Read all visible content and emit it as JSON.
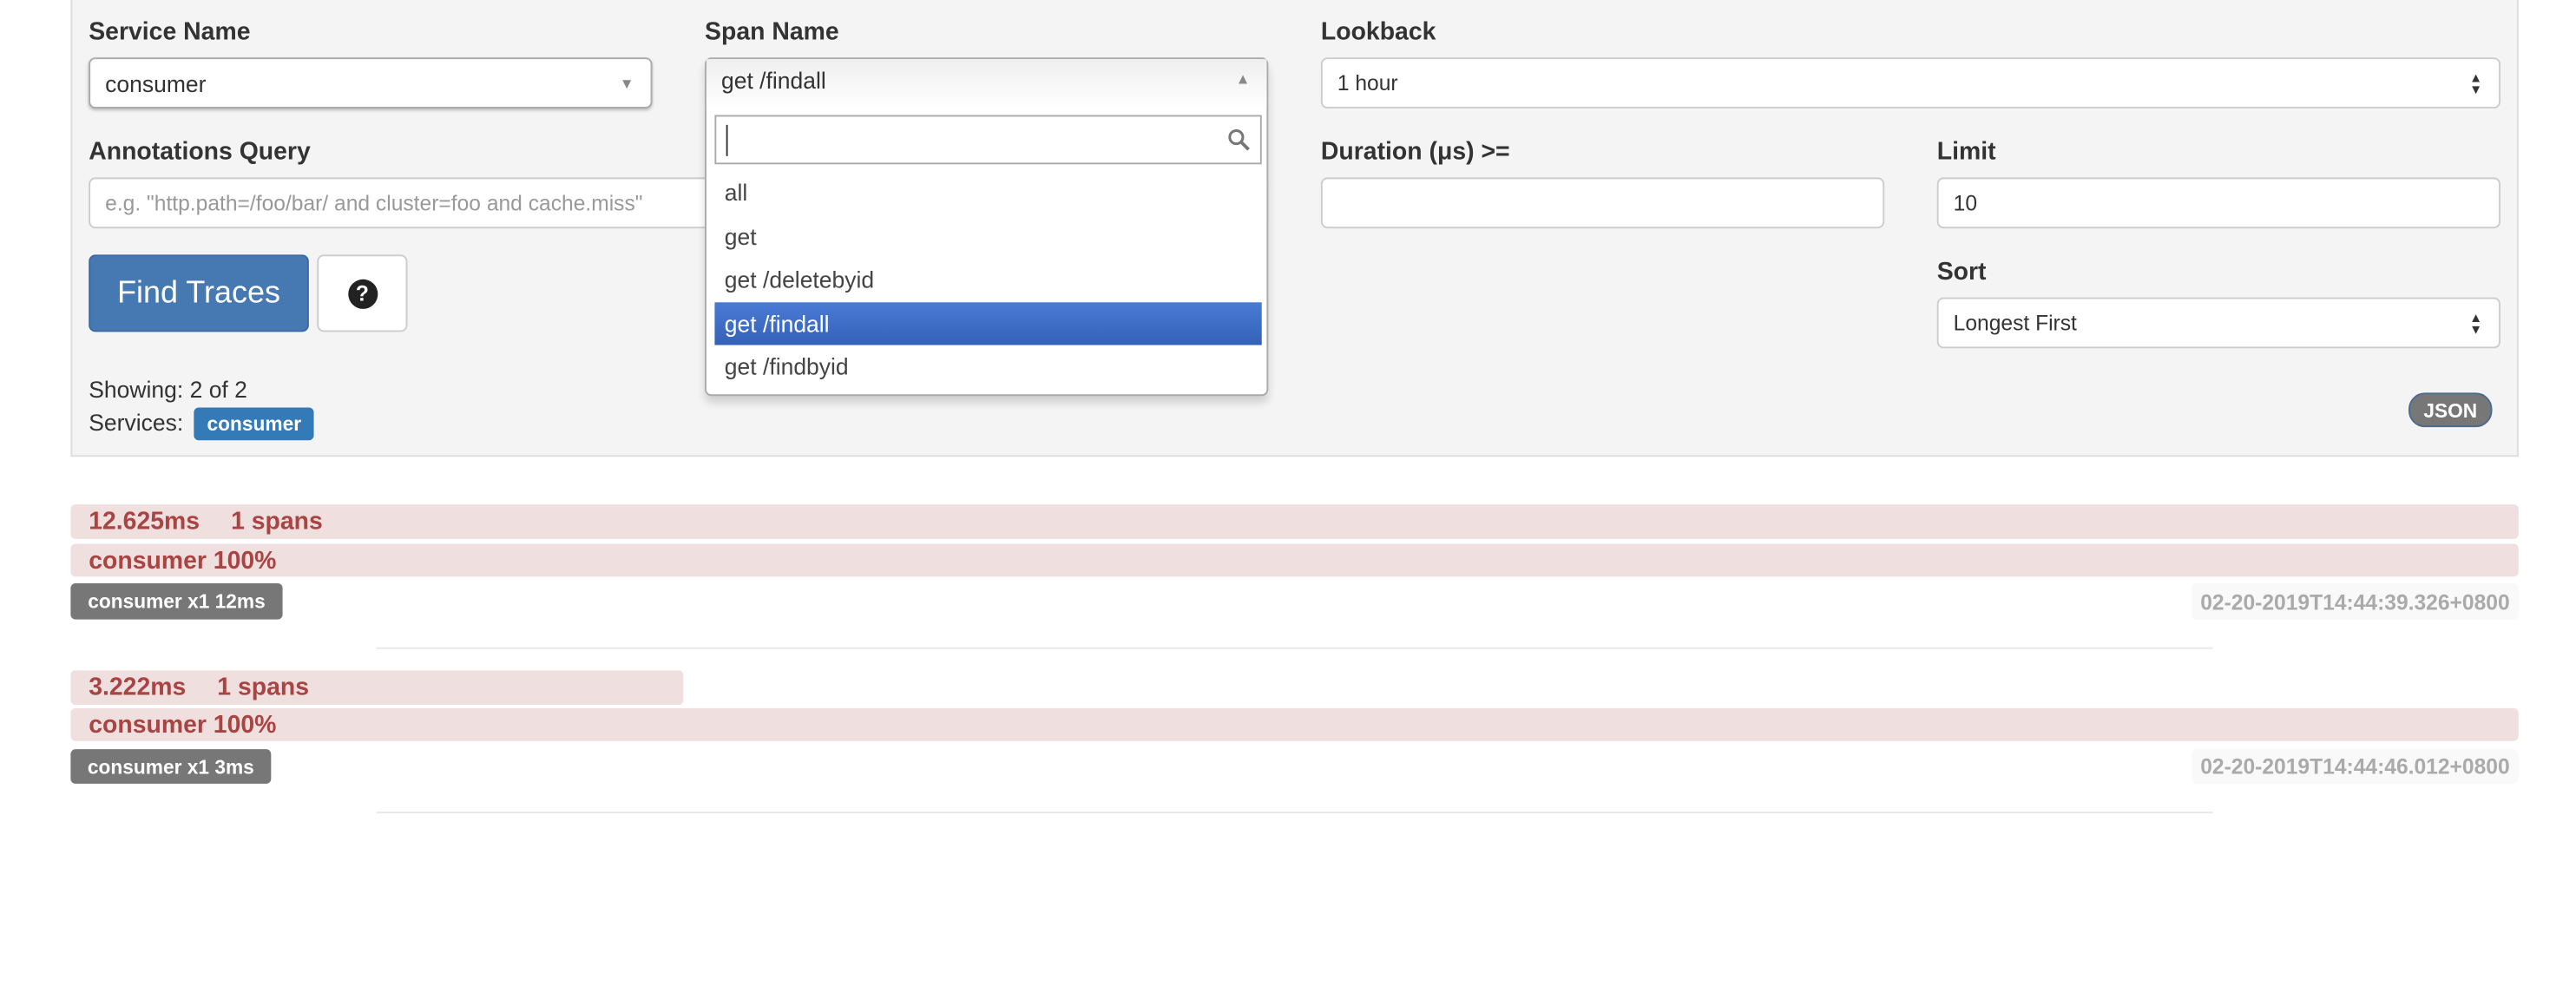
{
  "form": {
    "service_name": {
      "label": "Service Name",
      "value": "consumer"
    },
    "span_name": {
      "label": "Span Name",
      "value": "get /findall",
      "search_value": "",
      "options": [
        "all",
        "get",
        "get /deletebyid",
        "get /findall",
        "get /findbyid"
      ],
      "selected_index": 3
    },
    "lookback": {
      "label": "Lookback",
      "value": "1 hour"
    },
    "annotations_query": {
      "label": "Annotations Query",
      "placeholder": "e.g. \"http.path=/foo/bar/ and cluster=foo and cache.miss\""
    },
    "duration": {
      "label": "Duration (μs) >=",
      "value": ""
    },
    "limit": {
      "label": "Limit",
      "value": "10"
    },
    "sort": {
      "label": "Sort",
      "value": "Longest First"
    },
    "find_button": "Find Traces",
    "help_icon": "question-circle-icon"
  },
  "results": {
    "showing": "Showing: 2 of 2",
    "services_label": "Services:",
    "service_badge": "consumer",
    "json_button": "JSON"
  },
  "colors": {
    "primary": "#4679b2",
    "badge_blue": "#337ab7",
    "trace_bar": "#efdfdf",
    "trace_text": "#a94442",
    "selected_option": "#3d6fc8"
  },
  "traces": [
    {
      "duration": "12.625ms",
      "spans": "1 spans",
      "service_pct": "consumer 100%",
      "badge": "consumer x1 12ms",
      "timestamp": "02-20-2019T14:44:39.326+0800",
      "relative_width": 1.0
    },
    {
      "duration": "3.222ms",
      "spans": "1 spans",
      "service_pct": "consumer 100%",
      "badge": "consumer x1 3ms",
      "timestamp": "02-20-2019T14:44:46.012+0800",
      "relative_width": 0.255
    }
  ]
}
